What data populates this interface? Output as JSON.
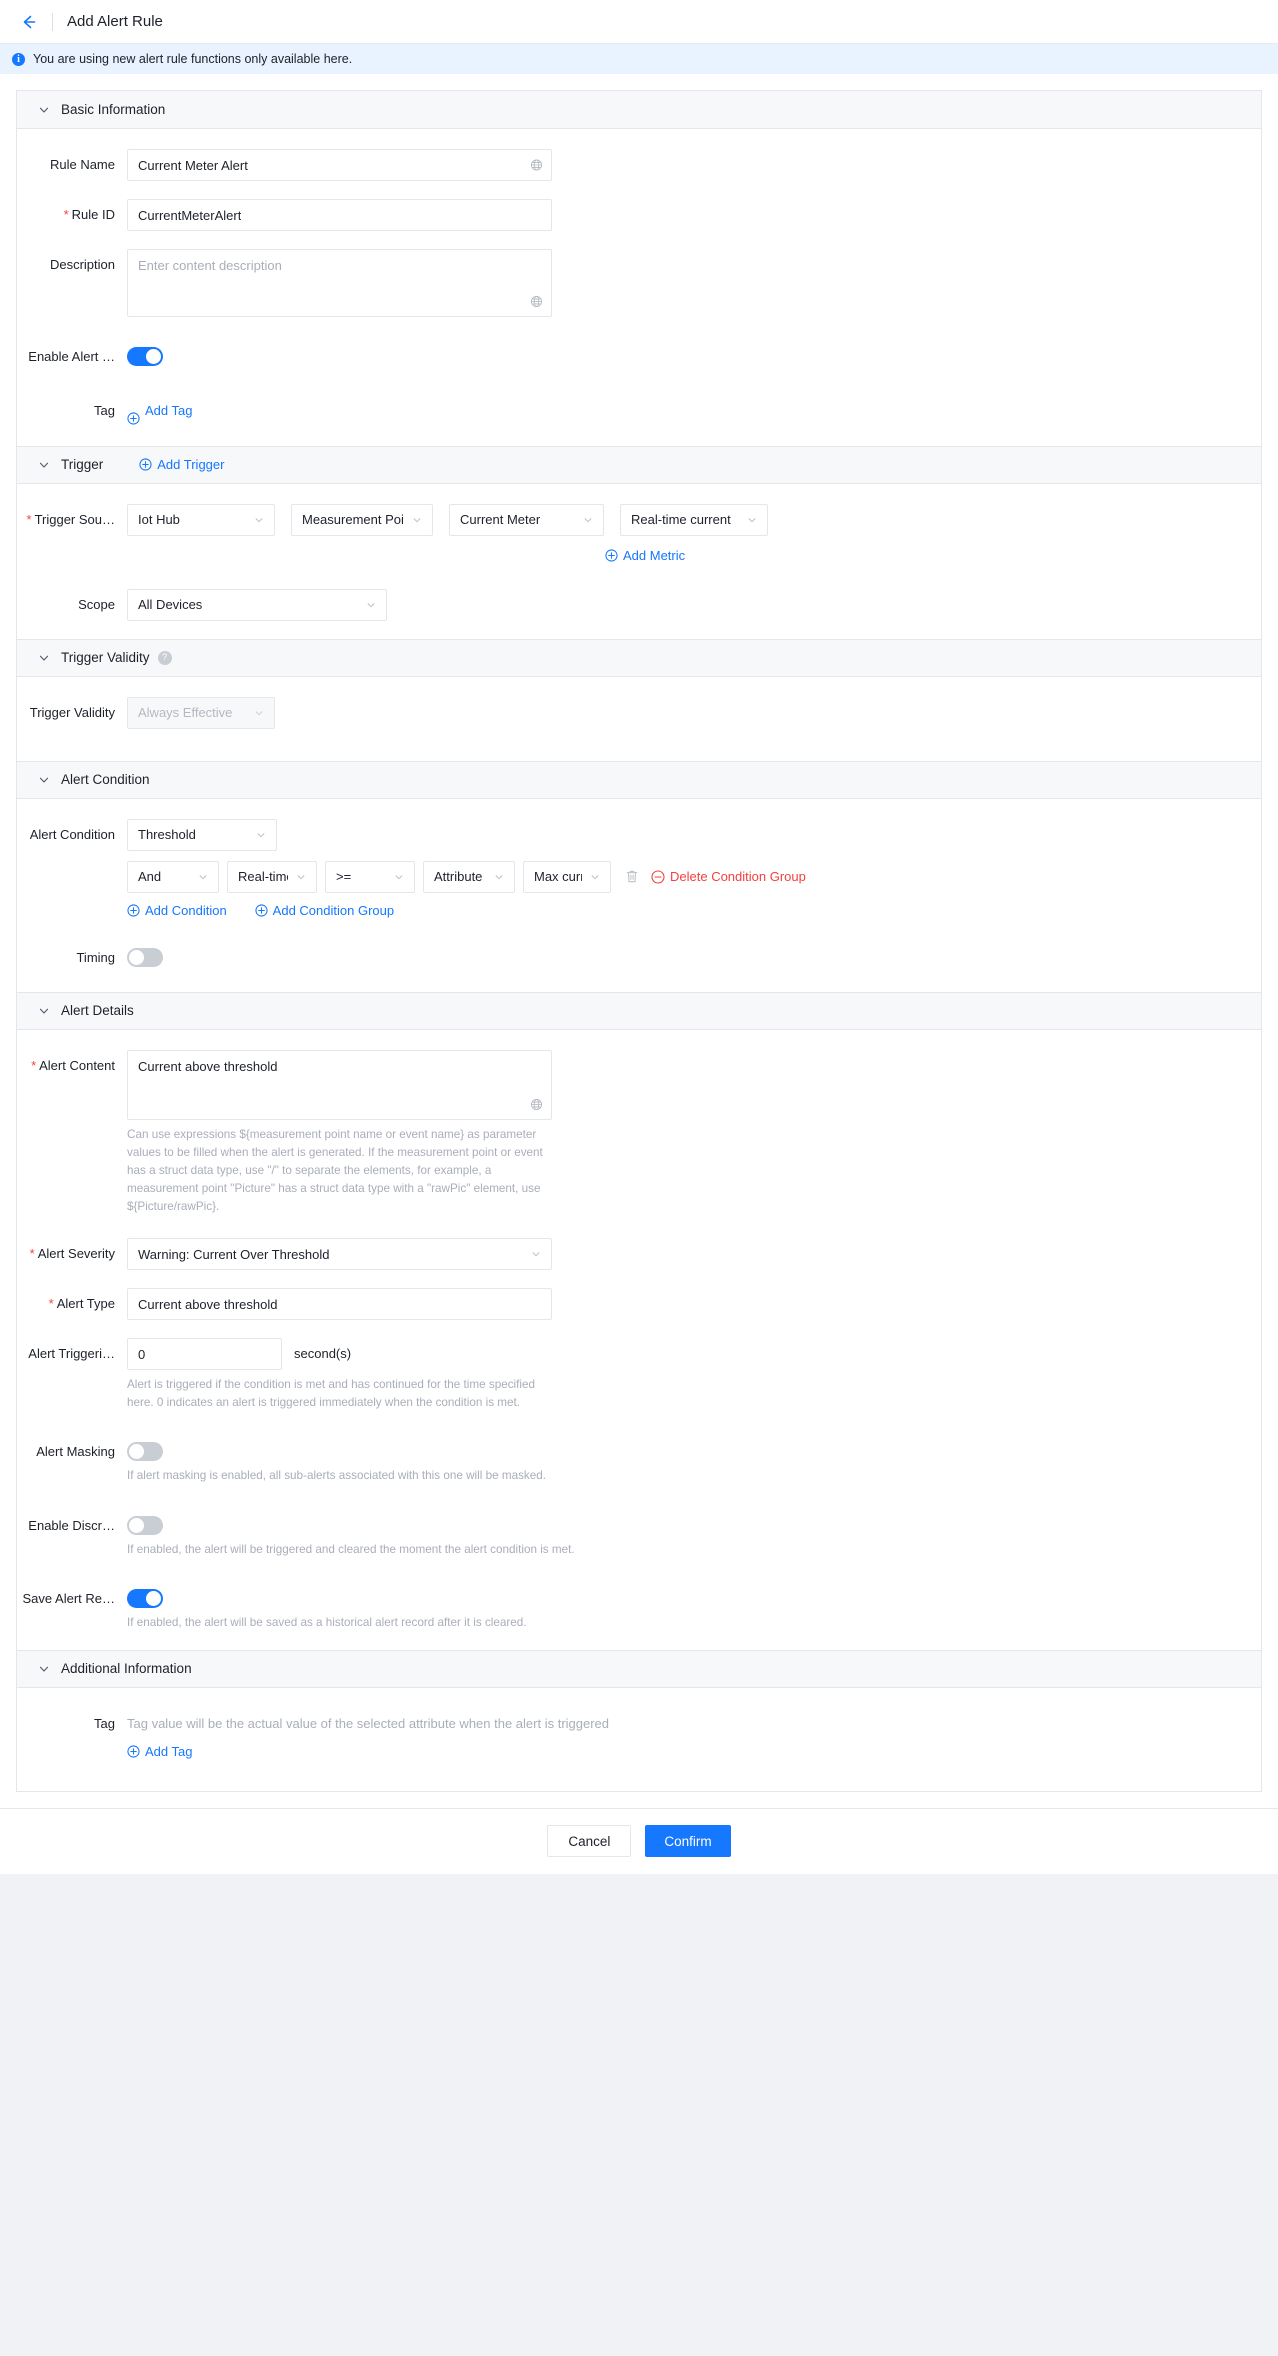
{
  "header": {
    "back_icon": "back-arrow-icon",
    "title": "Add Alert Rule"
  },
  "banner": {
    "icon": "info-circle-icon",
    "text": "You are using new alert rule functions only available here."
  },
  "colors": {
    "accent": "#1677ff",
    "banner_bg": "#e8f3ff",
    "section_bg": "#f7f8fa",
    "danger": "#f53f3f",
    "border": "#e5e6eb",
    "placeholder": "#a9aeb8"
  },
  "basic_information": {
    "title": "Basic Information",
    "rule_name": {
      "label": "Rule Name",
      "value": "Current Meter Alert"
    },
    "rule_id": {
      "label": "Rule ID",
      "value": "CurrentMeterAlert",
      "required": true
    },
    "description": {
      "label": "Description",
      "value": "",
      "placeholder": "Enter content description"
    },
    "enable_alert": {
      "label": "Enable Alert …",
      "state": "on"
    },
    "tag": {
      "label": "Tag",
      "add_label": "Add Tag"
    }
  },
  "trigger": {
    "title": "Trigger",
    "add_trigger_label": "Add Trigger",
    "trigger_source": {
      "label": "Trigger Sou…",
      "required": true,
      "selects": [
        "Iot Hub",
        "Measurement Point",
        "Current Meter",
        "Real-time current"
      ]
    },
    "add_metric_label": "Add Metric",
    "scope": {
      "label": "Scope",
      "value": "All Devices"
    }
  },
  "trigger_validity": {
    "title": "Trigger Validity",
    "help_icon": "question-mark-icon",
    "field": {
      "label": "Trigger Validity",
      "value": "Always Effective",
      "disabled": true
    }
  },
  "alert_condition": {
    "title": "Alert Condition",
    "condition_type": {
      "label": "Alert Condition",
      "value": "Threshold"
    },
    "condition_row": {
      "logic": "And",
      "metric": "Real-time…",
      "operator": ">=",
      "value_type": "Attribute",
      "attribute": "Max curr…",
      "delete_icon": "trash-icon",
      "delete_group_label": "Delete Condition Group"
    },
    "add_condition_label": "Add Condition",
    "add_condition_group_label": "Add Condition Group",
    "timing": {
      "label": "Timing",
      "state": "off"
    }
  },
  "alert_details": {
    "title": "Alert Details",
    "alert_content": {
      "label": "Alert Content",
      "required": true,
      "value": "Current above threshold",
      "globe_icon": "globe-icon",
      "hint": "Can use expressions ${measurement point name or event name} as parameter values to be filled when the alert is generated. If the measurement point or event has a struct data type, use \"/\" to separate the elements, for example, a measurement point \"Picture\" has a struct data type with a \"rawPic\" element, use ${Picture/rawPic}."
    },
    "alert_severity": {
      "label": "Alert Severity",
      "required": true,
      "value": "Warning: Current Over Threshold"
    },
    "alert_type": {
      "label": "Alert Type",
      "required": true,
      "value": "Current above threshold"
    },
    "alert_triggering": {
      "label": "Alert Triggeri…",
      "value": "0",
      "unit": "second(s)",
      "hint": "Alert is triggered if the condition is met and has continued for the time specified here. 0 indicates an alert is triggered immediately when the condition is met."
    },
    "alert_masking": {
      "label": "Alert Masking",
      "state": "off",
      "hint": "If alert masking is enabled, all sub-alerts associated with this one will be masked."
    },
    "enable_discrete": {
      "label": "Enable Discr…",
      "state": "off",
      "hint": "If enabled, the alert will be triggered and cleared the moment the alert condition is met."
    },
    "save_alert_record": {
      "label": "Save Alert Re…",
      "state": "on",
      "hint": "If enabled, the alert will be saved as a historical alert record after it is cleared."
    }
  },
  "additional_information": {
    "title": "Additional Information",
    "tag": {
      "label": "Tag",
      "placeholder": "Tag value will be the actual value of the selected attribute when the alert is triggered",
      "add_label": "Add Tag"
    }
  },
  "footer": {
    "cancel_label": "Cancel",
    "confirm_label": "Confirm"
  }
}
